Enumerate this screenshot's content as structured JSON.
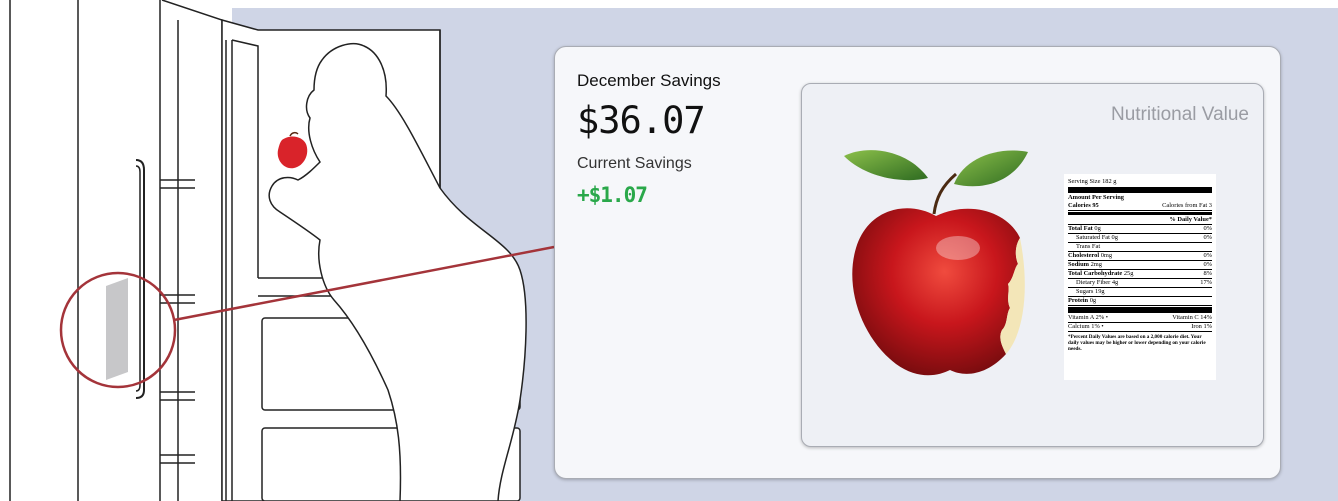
{
  "savings": {
    "title": "December Savings",
    "amount": "$36.07",
    "current_title": "Current Savings",
    "current_amount": "+$1.07"
  },
  "nutrition": {
    "title": "Nutritional Value",
    "serving_size": "Serving Size  182 g",
    "amount_per_serving": "Amount Per Serving",
    "calories": "Calories 95",
    "calories_from_fat": "Calories from Fat 3",
    "daily_value_header": "% Daily Value*",
    "rows": [
      {
        "name": "Total Fat",
        "amount": "0g",
        "dv": "0%",
        "bold": true,
        "indent": false
      },
      {
        "name": "Saturated Fat",
        "amount": "0g",
        "dv": "0%",
        "bold": false,
        "indent": true
      },
      {
        "name": "Trans Fat",
        "amount": "",
        "dv": "",
        "bold": false,
        "indent": true
      },
      {
        "name": "Cholesterol",
        "amount": "0mg",
        "dv": "0%",
        "bold": true,
        "indent": false
      },
      {
        "name": "Sodium",
        "amount": "2mg",
        "dv": "0%",
        "bold": true,
        "indent": false
      },
      {
        "name": "Total Carbohydrate",
        "amount": "25g",
        "dv": "8%",
        "bold": true,
        "indent": false
      },
      {
        "name": "Dietary Fiber",
        "amount": "4g",
        "dv": "17%",
        "bold": false,
        "indent": true
      },
      {
        "name": "Sugars",
        "amount": "19g",
        "dv": "",
        "bold": false,
        "indent": true
      },
      {
        "name": "Protein",
        "amount": "0g",
        "dv": "",
        "bold": true,
        "indent": false
      }
    ],
    "vitamins": [
      {
        "left_name": "Vitamin A",
        "left_dv": "2%",
        "right_name": "Vitamin C",
        "right_dv": "14%"
      },
      {
        "left_name": "Calcium",
        "left_dv": "1%",
        "right_name": "Iron",
        "right_dv": "1%"
      }
    ],
    "footnote": "*Percent Daily Values are based on a 2,000 calorie diet. Your daily values may be higher or lower depending on your calorie needs."
  },
  "colors": {
    "background": "#cfd5e6",
    "accent_red": "#a4343a",
    "savings_green": "#2aa84a"
  },
  "icons": [
    "refrigerator-illustration",
    "person-eating-apple-illustration",
    "door-display-panel",
    "apple-image"
  ]
}
